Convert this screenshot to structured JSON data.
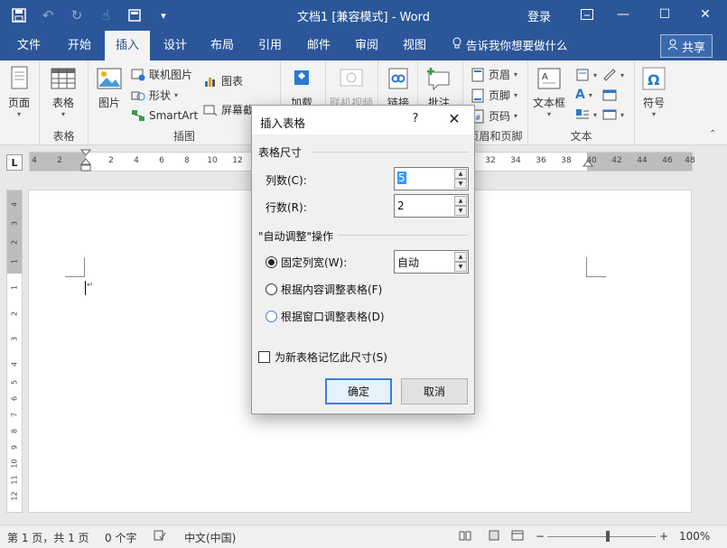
{
  "window": {
    "title": "文档1 [兼容模式] - Word",
    "login": "登录",
    "accent": "#2b579a"
  },
  "ribbon_tabs": [
    "文件",
    "开始",
    "插入",
    "设计",
    "布局",
    "引用",
    "邮件",
    "审阅",
    "视图"
  ],
  "active_tab": "插入",
  "tell_me": "告诉我你想要做什么",
  "share": "共享",
  "ribbon": {
    "pages": "页面",
    "table": "表格",
    "picture": "图片",
    "online_picture": "联机图片",
    "shapes": "形状",
    "smartart": "SmartArt",
    "chart": "图表",
    "screenshot": "屏幕截图",
    "addins": "加载",
    "online_video": "联机视频",
    "links": "链接",
    "comment": "批注",
    "header": "页眉",
    "footer": "页脚",
    "page_number": "页码",
    "textbox": "文本框",
    "symbol": "符号",
    "groups": {
      "table": "表格",
      "illustrations": "插图",
      "header_footer": "页眉和页脚",
      "text": "文本"
    }
  },
  "ruler_ticks": [
    "4",
    "2",
    "2",
    "4",
    "6",
    "8",
    "10",
    "12",
    "32",
    "34",
    "36",
    "38",
    "40",
    "42",
    "44",
    "46",
    "48"
  ],
  "vruler_ticks": [
    "4",
    "3",
    "2",
    "1",
    "1",
    "2",
    "3",
    "4",
    "5",
    "6",
    "7",
    "8",
    "9",
    "10",
    "11",
    "12"
  ],
  "dialog": {
    "title": "插入表格",
    "help": "?",
    "close": "✕",
    "table_size": "表格尺寸",
    "columns_label": "列数(C):",
    "columns_value": "5",
    "rows_label": "行数(R):",
    "rows_value": "2",
    "autofit_section": "\"自动调整\"操作",
    "fixed_width_label": "固定列宽(W):",
    "fixed_width_value": "自动",
    "autofit_contents": "根据内容调整表格(F)",
    "autofit_window": "根据窗口调整表格(D)",
    "remember": "为新表格记忆此尺寸(S)",
    "ok": "确定",
    "cancel": "取消"
  },
  "status": {
    "page": "第 1 页，共 1 页",
    "words": "0 个字",
    "language": "中文(中国)",
    "zoom": "100%"
  }
}
